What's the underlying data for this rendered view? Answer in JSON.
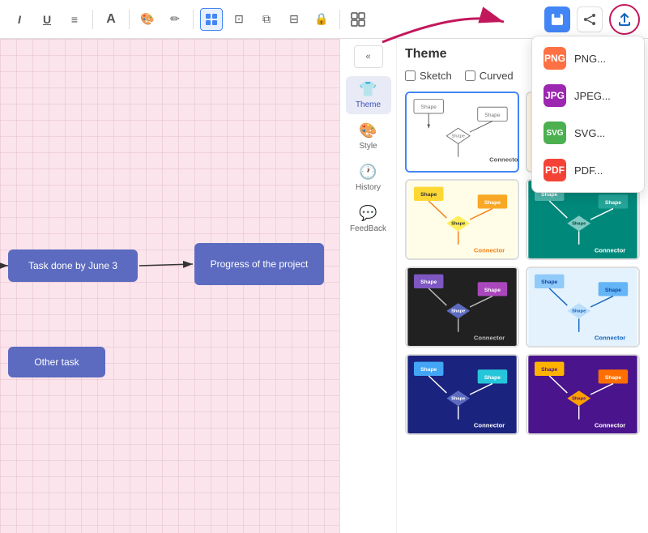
{
  "toolbar": {
    "italic_label": "I",
    "underline_label": "U",
    "list_label": "≡",
    "font_label": "A",
    "paint_label": "🎨",
    "pen_label": "✏",
    "layout_label": "⊞",
    "crop_label": "⊡",
    "duplicate_label": "⧉",
    "align_label": "⊟",
    "lock_label": "🔒",
    "grid_label": "⊞",
    "save_label": "💾",
    "share_label": "↗",
    "export_label": "⬆"
  },
  "export_dropdown": {
    "png_label": "PNG...",
    "jpeg_label": "JPEG...",
    "svg_label": "SVG...",
    "pdf_label": "PDF..."
  },
  "sidebar": {
    "collapse_label": "«",
    "theme_label": "Theme",
    "style_label": "Style",
    "history_label": "History",
    "feedback_label": "FeedBack"
  },
  "theme_panel": {
    "title": "Theme",
    "sketch_label": "Sketch",
    "curved_label": "Curved"
  },
  "canvas": {
    "shape1_label": "Task done by June 3",
    "shape2_label": "Progress of the project",
    "shape3_label": "Other task"
  },
  "theme_cards": [
    {
      "id": "default",
      "bg": "#ffffff",
      "shapes": [
        "#6c63ff",
        "#6c63ff",
        "#6c63ff"
      ],
      "connector_color": "#333",
      "selected": true
    },
    {
      "id": "warm",
      "bg": "#fff3e0",
      "shapes": [
        "#ffb74d",
        "#ff8a65",
        "#ffcc02"
      ],
      "connector_color": "#ff7043",
      "selected": false
    },
    {
      "id": "yellow",
      "bg": "#fffde7",
      "shapes": [
        "#fdd835",
        "#f9a825",
        "#ffee58"
      ],
      "connector_color": "#f57f17",
      "selected": false
    },
    {
      "id": "teal",
      "bg": "#00897b",
      "shapes": [
        "#4db6ac",
        "#26a69a",
        "#80cbc4"
      ],
      "connector_color": "#004d40",
      "selected": false
    },
    {
      "id": "dark",
      "bg": "#212121",
      "shapes": [
        "#7e57c2",
        "#ab47bc",
        "#5c6bc0"
      ],
      "connector_color": "#bdbdbd",
      "selected": false
    },
    {
      "id": "light-blue",
      "bg": "#e3f2fd",
      "shapes": [
        "#90caf9",
        "#64b5f6",
        "#bbdefb"
      ],
      "connector_color": "#1565c0",
      "selected": false
    },
    {
      "id": "navy",
      "bg": "#1a237e",
      "shapes": [
        "#42a5f5",
        "#26c6da",
        "#5c6bc0"
      ],
      "connector_color": "#ffffff",
      "selected": false
    },
    {
      "id": "purple-dark",
      "bg": "#4a148c",
      "shapes": [
        "#ffb300",
        "#ff6f00",
        "#ffa000"
      ],
      "connector_color": "#ffffff",
      "selected": false
    }
  ]
}
